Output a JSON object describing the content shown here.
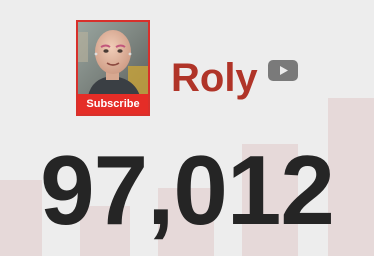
{
  "channel": {
    "name": "Roly",
    "subscribe_label": "Subscribe",
    "subscriber_count": "97,012",
    "platform_icon": "youtube-icon"
  },
  "colors": {
    "accent_red": "#e52d27",
    "name_red": "#b03428",
    "count_text": "#252525",
    "background": "#ededed",
    "chart_bars": "#e6d9d9"
  }
}
